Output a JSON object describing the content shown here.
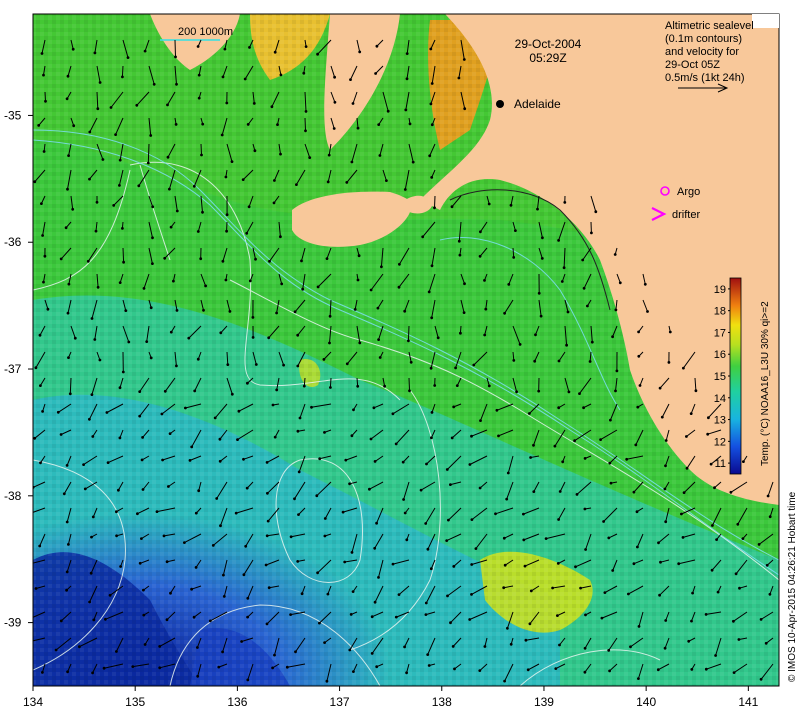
{
  "map": {
    "date_line": "29-Oct-2004",
    "time_line": "05:29Z",
    "scale_label": "200  1000m",
    "city": "Adelaide",
    "legend": {
      "line1": "Altimetric sealevel",
      "line2": "(0.1m contours)",
      "line3": "and velocity for",
      "line4": "29-Oct 05Z",
      "line5": "0.5m/s (1kt 24h)",
      "argo_label": "Argo",
      "drifter_label": "drifter",
      "argo_color": "#ff00ff",
      "drifter_color": "#ff00ff"
    },
    "colorbar": {
      "title": "Temp. (°C) NOAA16_L3U 30% qi>=2",
      "ticks": [
        "11",
        "12",
        "13",
        "14",
        "15",
        "16",
        "17",
        "18",
        "19"
      ],
      "min": 10.5,
      "max": 19.5
    },
    "credit": "© IMOS 10-Apr-2015 04:26:21 Hobart time",
    "axes": {
      "lon_ticks": [
        "134",
        "135",
        "136",
        "137",
        "138",
        "139",
        "140",
        "141"
      ],
      "lat_ticks": [
        "-35",
        "-36",
        "-37",
        "-38",
        "-39"
      ],
      "lon_range": [
        134,
        141.3
      ],
      "lat_range": [
        -39.5,
        -34.2
      ]
    },
    "colors": {
      "land": "#f8c89a",
      "ocean_green": "#3cc83c",
      "ocean_cyan": "#2ec8b4",
      "ocean_blue": "#2a64d2",
      "deep_blue": "#0a2aa0",
      "warm": "#e0a020"
    }
  }
}
